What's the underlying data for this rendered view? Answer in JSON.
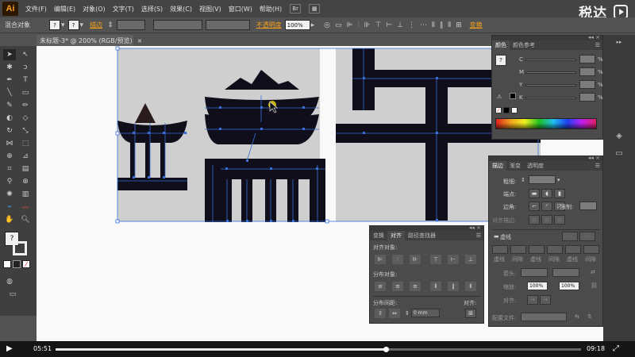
{
  "app": {
    "logo": "Ai",
    "watermark": "税达",
    "watermark_icon": "play-circle-icon"
  },
  "menu": [
    "文件(F)",
    "编辑(E)",
    "对象(O)",
    "文字(T)",
    "选择(S)",
    "效果(C)",
    "视图(V)",
    "窗口(W)",
    "帮助(H)"
  ],
  "menu_icons": {
    "bridge": "Br",
    "arrange": "▦"
  },
  "controlbar": {
    "selection_label": "混合对象",
    "stroke_label": "描边",
    "opacity_label": "不透明度",
    "opacity_value": "100%",
    "transform_label": "变换"
  },
  "document_tab": {
    "title": "未标题-3* @ 200% (RGB/预览)",
    "close": "×"
  },
  "color_panel": {
    "tabs": [
      "颜色",
      "颜色参考"
    ],
    "channels": [
      "C",
      "M",
      "Y",
      "K"
    ],
    "unit": "%"
  },
  "stroke_panel": {
    "tabs": [
      "描边",
      "渐变",
      "透明度"
    ],
    "weight_label": "粗细:",
    "cap_label": "端点:",
    "corner_label": "边角:",
    "limit_label": "限制:",
    "align_label": "对齐描边:",
    "dashed_label": "虚线",
    "dash_labels": [
      "虚线",
      "间隙",
      "虚线",
      "间隙",
      "虚线",
      "间隙"
    ],
    "arrow_label": "箭头:",
    "scale_label": "缩放:",
    "scale_value_1": "100%",
    "scale_value_2": "100%",
    "align2_label": "对齐:",
    "profile_label": "配置文件:"
  },
  "align_panel": {
    "tabs": [
      "变换",
      "对齐",
      "路径查找器"
    ],
    "align_objects_label": "对齐对象:",
    "distribute_objects_label": "分布对象:",
    "distribute_spacing_label": "分布间距:",
    "align_to_label": "对齐:",
    "spacing_value": "0 mm"
  },
  "player": {
    "current_time": "05:51",
    "total_time": "09:18",
    "progress": 0.629
  }
}
